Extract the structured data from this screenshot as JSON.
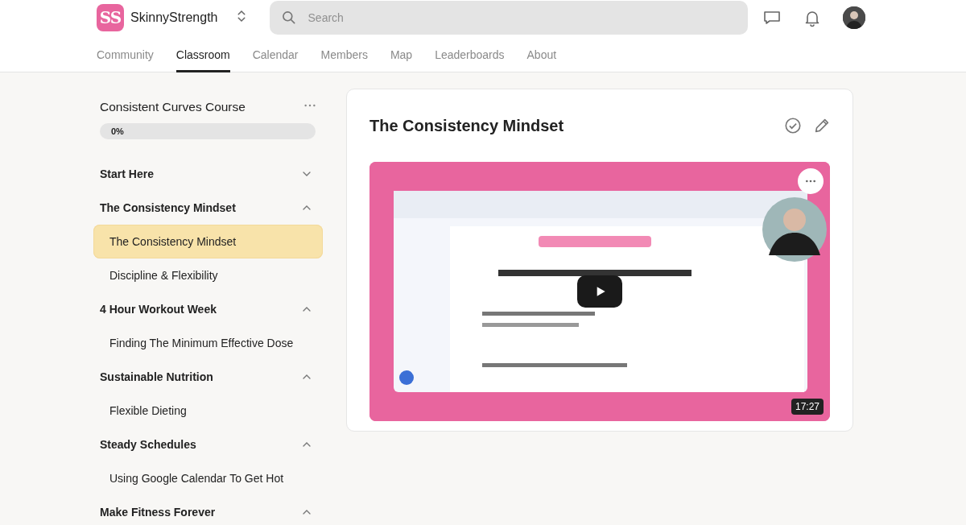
{
  "header": {
    "logo_text": "SS",
    "community_name": "SkinnyStrength",
    "search": {
      "placeholder": "Search"
    }
  },
  "tabs": [
    {
      "label": "Community",
      "selected": false
    },
    {
      "label": "Classroom",
      "selected": true
    },
    {
      "label": "Calendar",
      "selected": false
    },
    {
      "label": "Members",
      "selected": false
    },
    {
      "label": "Map",
      "selected": false
    },
    {
      "label": "Leaderboards",
      "selected": false
    },
    {
      "label": "About",
      "selected": false
    }
  ],
  "course": {
    "title": "Consistent Curves Course",
    "progress": {
      "level": 0,
      "reading": "0%"
    },
    "sections": [
      {
        "title": "Start Here",
        "expanded": false
      },
      {
        "title": "The Consistency Mindset",
        "expanded": true,
        "lessons": [
          {
            "title": "The Consistency Mindset",
            "selected": true
          },
          {
            "title": "Discipline & Flexibility",
            "selected": false
          }
        ]
      },
      {
        "title": "4 Hour Workout Week",
        "expanded": true,
        "lessons": [
          {
            "title": "Finding The Minimum Effective Dose",
            "selected": false
          }
        ]
      },
      {
        "title": "Sustainable Nutrition",
        "expanded": true,
        "lessons": [
          {
            "title": "Flexible Dieting",
            "selected": false
          }
        ]
      },
      {
        "title": "Steady Schedules",
        "expanded": true,
        "lessons": [
          {
            "title": "Using Google Calendar To Get Hot",
            "selected": false
          }
        ]
      },
      {
        "title": "Make Fitness Forever",
        "expanded": true
      }
    ]
  },
  "lesson": {
    "title": "The Consistency Mindset",
    "completed": false,
    "video": {
      "kind": "picture",
      "duration": "17:27"
    }
  }
}
